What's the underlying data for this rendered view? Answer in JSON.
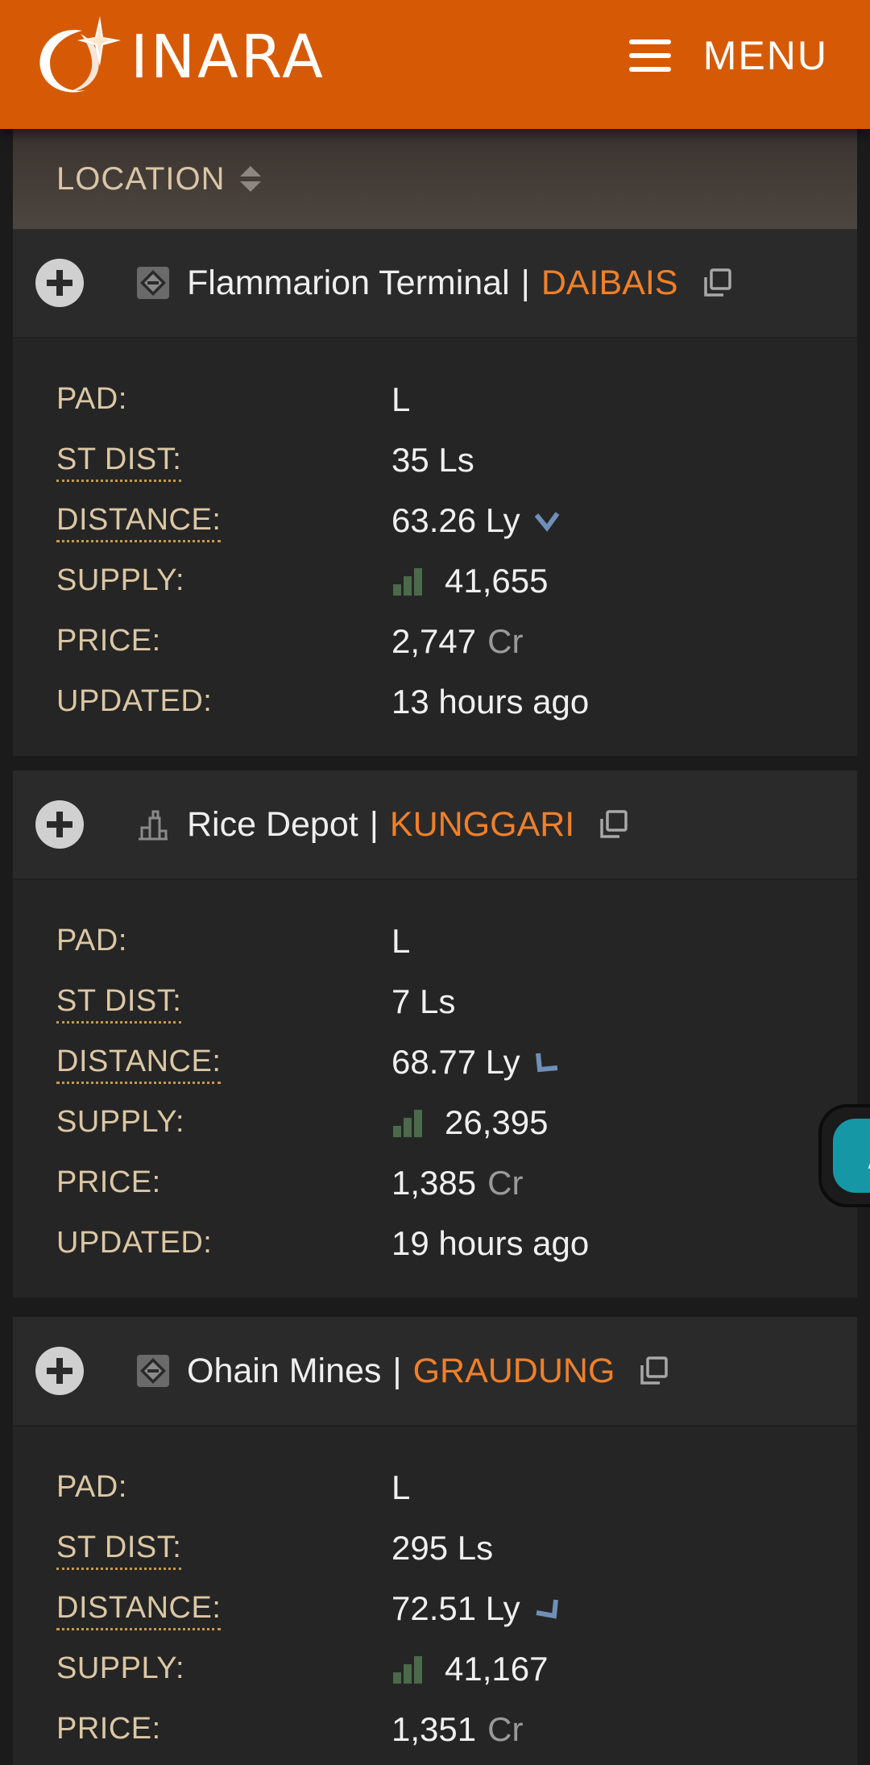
{
  "header": {
    "logo_text": "INARA",
    "menu_label": "MENU"
  },
  "table": {
    "column_label": "LOCATION"
  },
  "labels": {
    "pad": "PAD:",
    "st_dist": "ST DIST:",
    "distance": "DISTANCE:",
    "supply": "SUPPLY:",
    "price": "PRICE:",
    "updated": "UPDATED:"
  },
  "stations": [
    {
      "name": "Flammarion Terminal",
      "separator": "|",
      "system": "DAIBAIS",
      "icon": "coriolis-station-icon",
      "pad": "L",
      "st_dist": "35 Ls",
      "distance": "63.26 Ly",
      "distance_arrow": "arrow-down-icon",
      "supply": "41,655",
      "price": "2,747",
      "price_unit": "Cr",
      "updated": "13 hours ago"
    },
    {
      "name": "Rice Depot",
      "separator": "|",
      "system": "KUNGGARI",
      "icon": "surface-settlement-icon",
      "pad": "L",
      "st_dist": "7 Ls",
      "distance": "68.77 Ly",
      "distance_arrow": "arrow-down-left-icon",
      "supply": "26,395",
      "price": "1,385",
      "price_unit": "Cr",
      "updated": "19 hours ago"
    },
    {
      "name": "Ohain Mines",
      "separator": "|",
      "system": "GRAUDUNG",
      "icon": "coriolis-station-icon",
      "pad": "L",
      "st_dist": "295 Ls",
      "distance": "72.51 Ly",
      "distance_arrow": "arrow-down-right-icon",
      "supply": "41,167",
      "price": "1,351",
      "price_unit": "Cr",
      "updated": ""
    }
  ],
  "colors": {
    "header_bg": "#d65a05",
    "system_link": "#f0802a",
    "label": "#dcc7a4",
    "fab": "#1597a6"
  }
}
